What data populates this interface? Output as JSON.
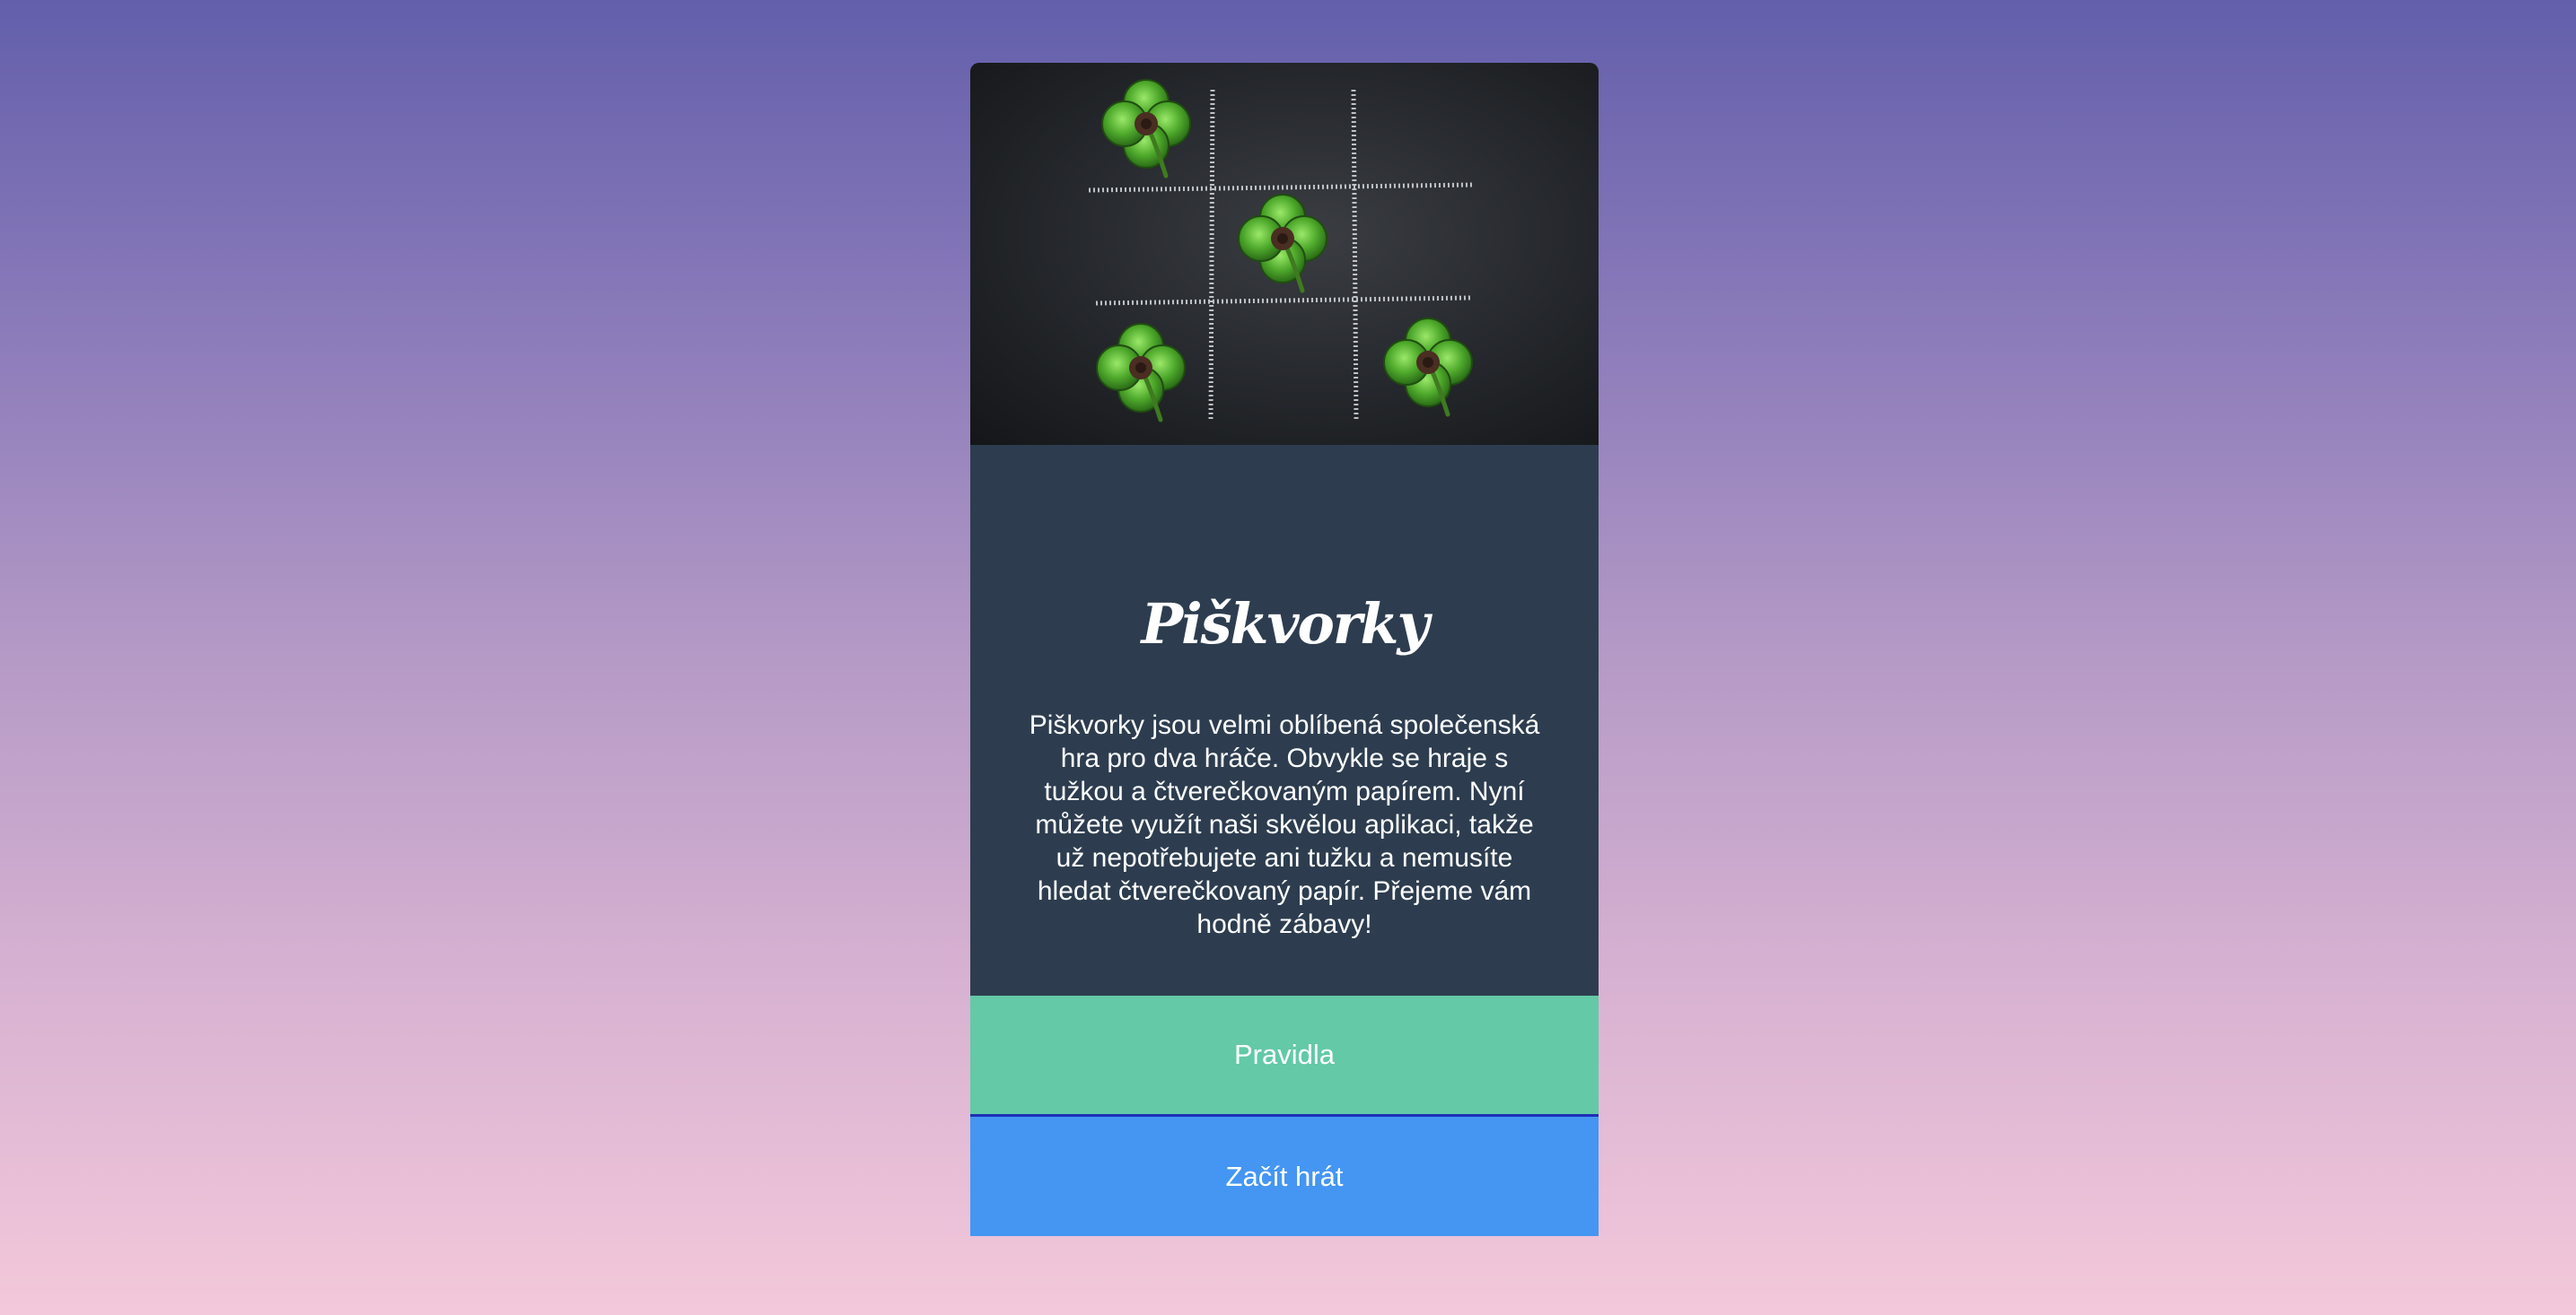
{
  "hero": {
    "image": "chalkboard-tic-tac-toe-clovers"
  },
  "game": {
    "title": "Piškvorky",
    "description": "Piškvorky jsou velmi oblíbená společenská hra pro dva hráče. Obvykle se hraje s tužkou a čtverečkovaným papírem. Nyní můžete využít naši skvělou aplikaci, takže už nepotřebujete ani tužku a nemusíte hledat čtverečkovaný papír. Přejeme vám hodně zábavy!"
  },
  "buttons": {
    "rules_label": "Pravidla",
    "play_label": "Začít hrát"
  },
  "colors": {
    "panel": "#2d3d4f",
    "rules_button": "#63c9a6",
    "play_button": "#4496f2",
    "divider": "#1d2fb8"
  }
}
